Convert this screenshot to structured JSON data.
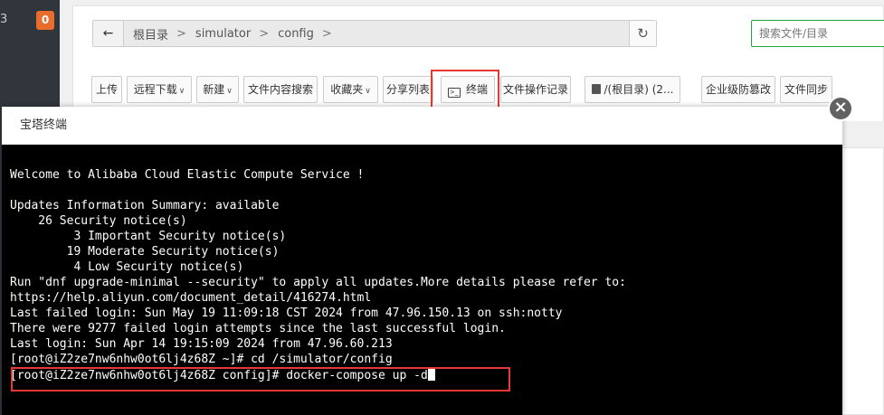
{
  "sidebar": {
    "version_fragment": "3",
    "badge_count": "0"
  },
  "breadcrumb": {
    "back_icon": "←",
    "items": [
      "根目录",
      "simulator",
      "config"
    ],
    "separator": ">",
    "refresh_icon": "↻"
  },
  "search": {
    "placeholder": "搜索文件/目录"
  },
  "toolbar": {
    "upload": "上传",
    "remote_download": "远程下载",
    "new": "新建",
    "content_search": "文件内容搜索",
    "favorites": "收藏夹",
    "share_list": "分享列表",
    "terminal": "终端",
    "terminal_icon_text": ">_",
    "file_log": "文件操作记录",
    "root_disk": "/(根目录) (2...",
    "tamper_protection": "企业级防篡改",
    "file_sync": "文件同步",
    "caret": "∨"
  },
  "modal": {
    "title": "宝塔终端",
    "close_icon": "×",
    "terminal_lines": [
      "Welcome to Alibaba Cloud Elastic Compute Service !",
      "",
      "Updates Information Summary: available",
      "    26 Security notice(s)",
      "         3 Important Security notice(s)",
      "        19 Moderate Security notice(s)",
      "         4 Low Security notice(s)",
      "Run \"dnf upgrade-minimal --security\" to apply all updates.More details please refer to:",
      "https://help.aliyun.com/document_detail/416274.html",
      "Last failed login: Sun May 19 11:09:18 CST 2024 from 47.96.150.13 on ssh:notty",
      "There were 9277 failed login attempts since the last successful login.",
      "Last login: Sun Apr 14 19:15:09 2024 from 47.96.60.213",
      "[root@iZ2ze7nw6nhw0ot6lj4z68Z ~]# cd /simulator/config"
    ],
    "prompt_line": "[root@iZ2ze7nw6nhw0ot6lj4z68Z config]# docker-compose up -d"
  },
  "colors": {
    "highlight": "#e53935",
    "accent_green": "#20a53a",
    "badge": "#e86d2c"
  }
}
